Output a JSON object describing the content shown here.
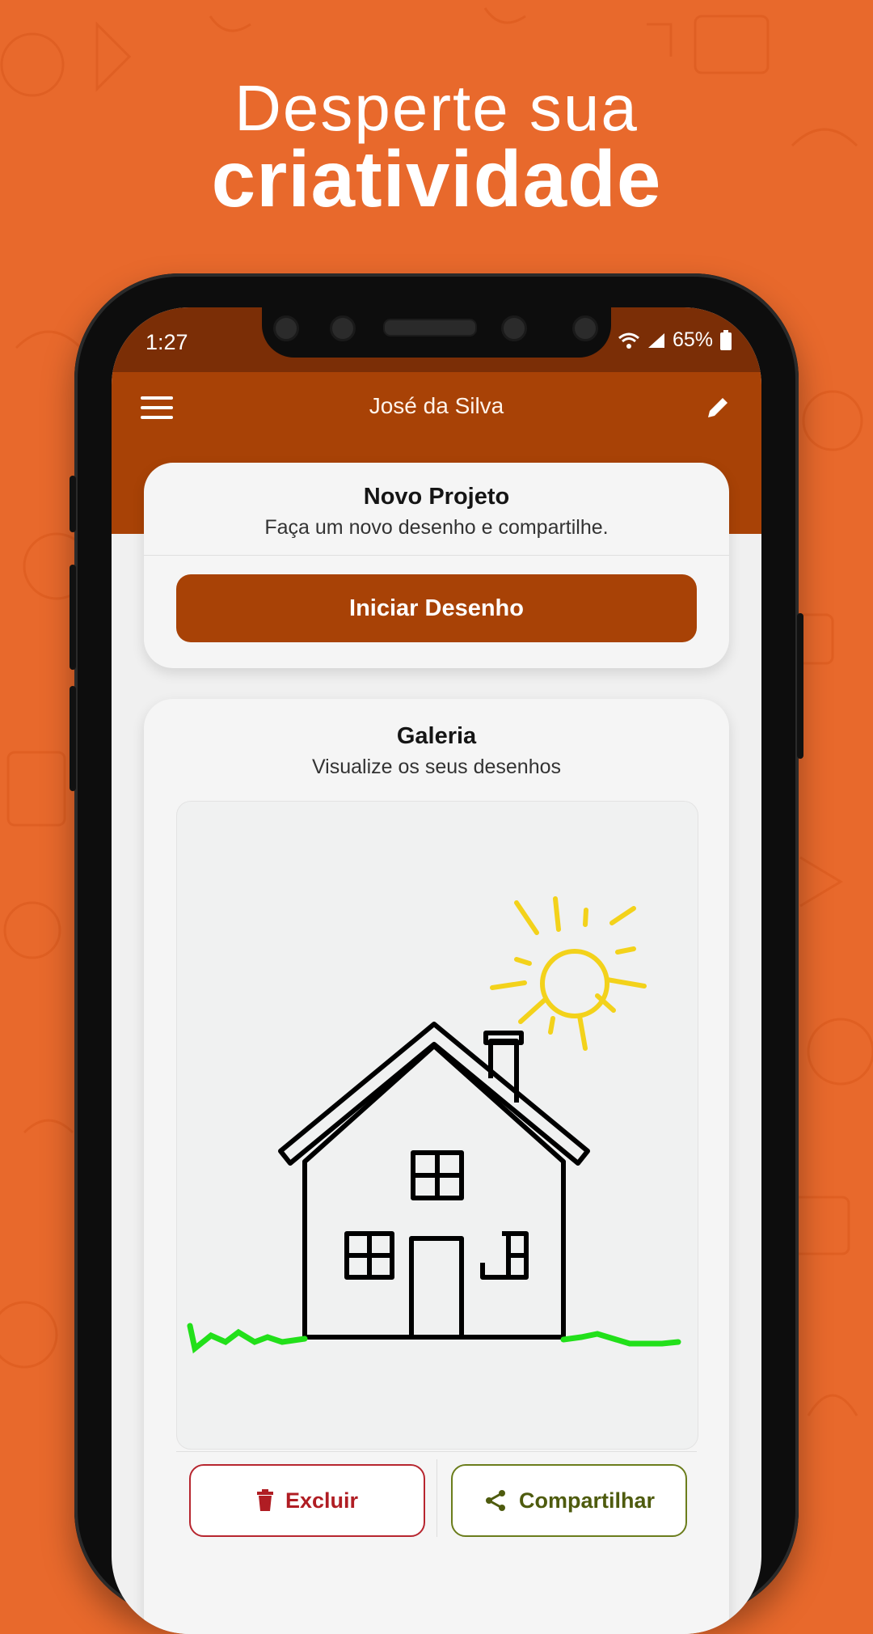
{
  "headline": {
    "line1": "Desperte sua",
    "line2": "criatividade"
  },
  "status": {
    "time": "1:27",
    "battery": "65%",
    "icons": [
      "wifi-icon",
      "signal-icon",
      "battery-icon"
    ]
  },
  "appbar": {
    "title": "José da Silva",
    "left_icon": "menu-icon",
    "right_icon": "edit-icon"
  },
  "new_project": {
    "title": "Novo Projeto",
    "subtitle": "Faça um novo desenho e compartilhe.",
    "button_label": "Iniciar Desenho"
  },
  "gallery": {
    "title": "Galeria",
    "subtitle": "Visualize os seus desenhos",
    "delete_label": "Excluir",
    "share_label": "Compartilhar"
  },
  "colors": {
    "background": "#e8692c",
    "primary": "#a84206",
    "status_bar": "#7b2e06",
    "delete": "#b01d23",
    "share": "#4e5b0e",
    "sun": "#f3d21b",
    "grass": "#22e01a"
  }
}
